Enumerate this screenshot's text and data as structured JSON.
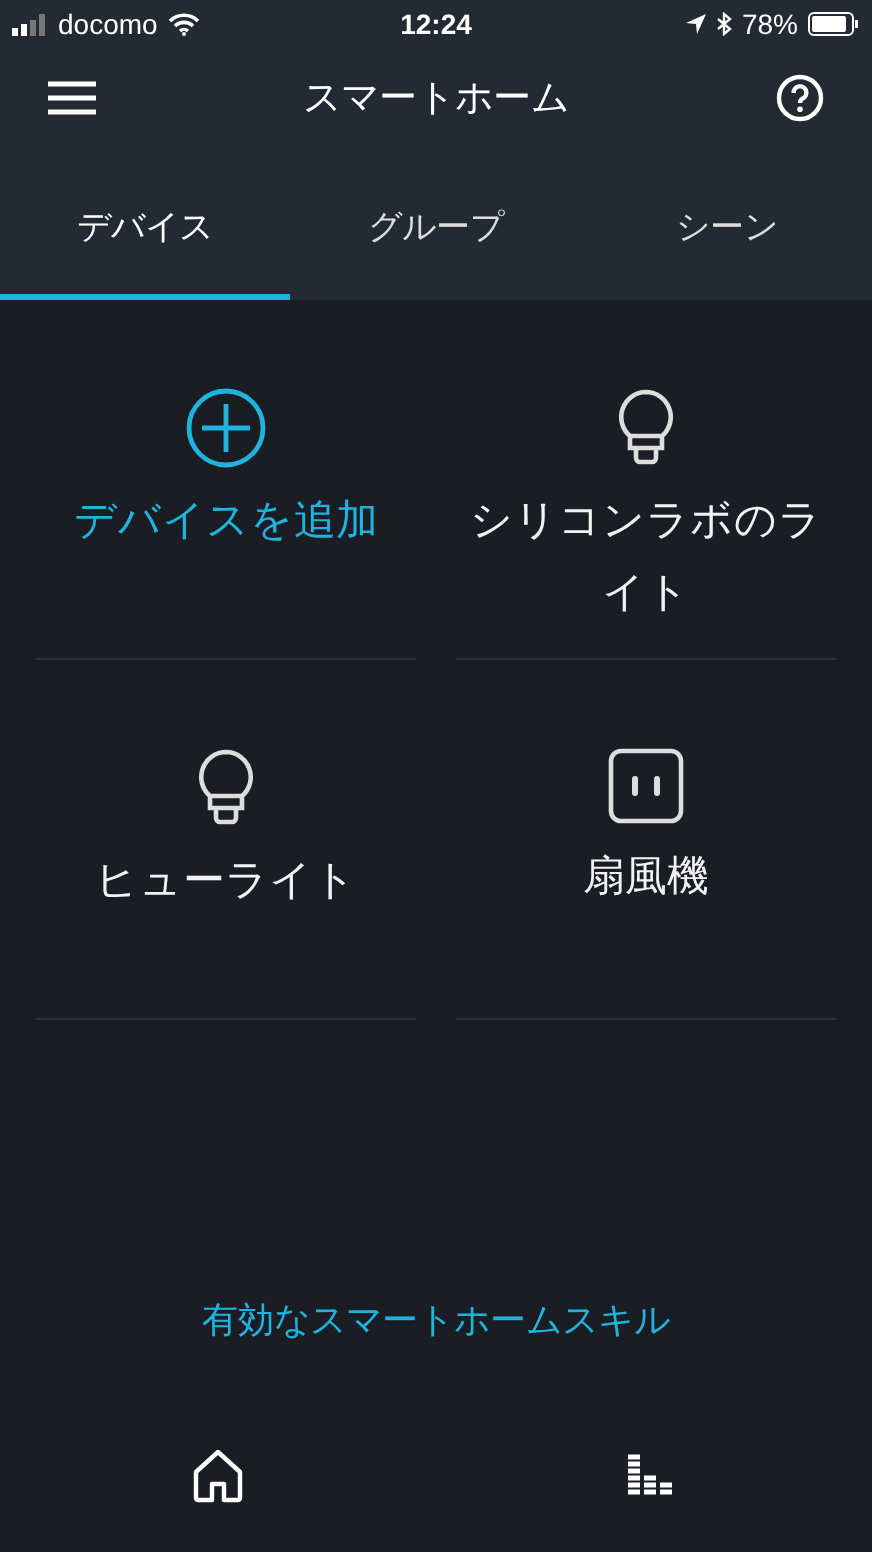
{
  "status_bar": {
    "carrier": "docomo",
    "time": "12:24",
    "battery": "78%"
  },
  "header": {
    "title": "スマートホーム"
  },
  "tabs": [
    {
      "label": "デバイス",
      "selected": true
    },
    {
      "label": "グループ",
      "selected": false
    },
    {
      "label": "シーン",
      "selected": false
    }
  ],
  "devices": [
    {
      "kind": "add",
      "label": "デバイスを追加"
    },
    {
      "kind": "light",
      "label": "シリコンラボのライト"
    },
    {
      "kind": "light",
      "label": "ヒューライト"
    },
    {
      "kind": "plug",
      "label": "扇風機"
    }
  ],
  "skills_link": "有効なスマートホームスキル",
  "bottom_nav": [
    {
      "kind": "home"
    },
    {
      "kind": "activity"
    }
  ]
}
